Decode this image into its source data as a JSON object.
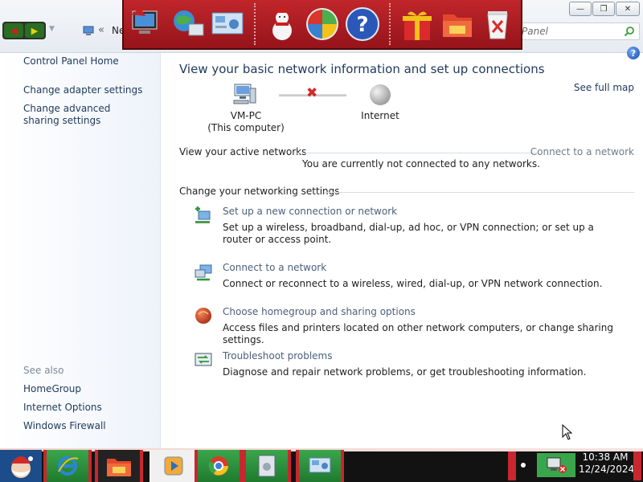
{
  "window": {
    "address_crumb": "«",
    "address_text": "Ne",
    "search_text": "Panel",
    "min_glyph": "—",
    "max_glyph": "❐",
    "close_glyph": "✕"
  },
  "dock": {
    "icons": [
      "computer-icon",
      "network-globe-icon",
      "control-panel-icon",
      "snowman-icon",
      "windows-logo-icon",
      "help-icon",
      "gift-icon",
      "folder-icon",
      "recycle-bin-icon"
    ]
  },
  "sidebar": {
    "home": "Control Panel Home",
    "links": [
      "Change adapter settings",
      "Change advanced sharing settings"
    ],
    "see_also_heading": "See also",
    "see_also": [
      "HomeGroup",
      "Internet Options",
      "Windows Firewall"
    ]
  },
  "main": {
    "title": "View your basic network information and set up connections",
    "see_full_map": "See full map",
    "help_glyph": "?",
    "map": {
      "computer_name": "VM-PC",
      "computer_sub": "(This computer)",
      "internet_label": "Internet",
      "disconnected_glyph": "✖"
    },
    "active_networks": {
      "heading": "View your active networks",
      "connect_link": "Connect to a network",
      "status": "You are currently not connected to any networks."
    },
    "settings": {
      "heading": "Change your networking settings",
      "tasks": [
        {
          "title": "Set up a new connection or network",
          "desc": "Set up a wireless, broadband, dial-up, ad hoc, or VPN connection; or set up a router or access point.",
          "icon": "new-connection-icon"
        },
        {
          "title": "Connect to a network",
          "desc": "Connect or reconnect to a wireless, wired, dial-up, or VPN network connection.",
          "icon": "connect-network-icon"
        },
        {
          "title": "Choose homegroup and sharing options",
          "desc": "Access files and printers located on other network computers, or change sharing settings.",
          "icon": "homegroup-icon"
        },
        {
          "title": "Troubleshoot problems",
          "desc": "Diagnose and repair network problems, or get troubleshooting information.",
          "icon": "troubleshoot-icon"
        }
      ]
    }
  },
  "taskbar": {
    "clock_time": "10:38 AM",
    "clock_date": "12/24/2024"
  },
  "colors": {
    "link": "#1e395b",
    "task_title": "#4c607a",
    "dock_red": "#c0262b",
    "taskbar_green": "#3aa64b"
  }
}
